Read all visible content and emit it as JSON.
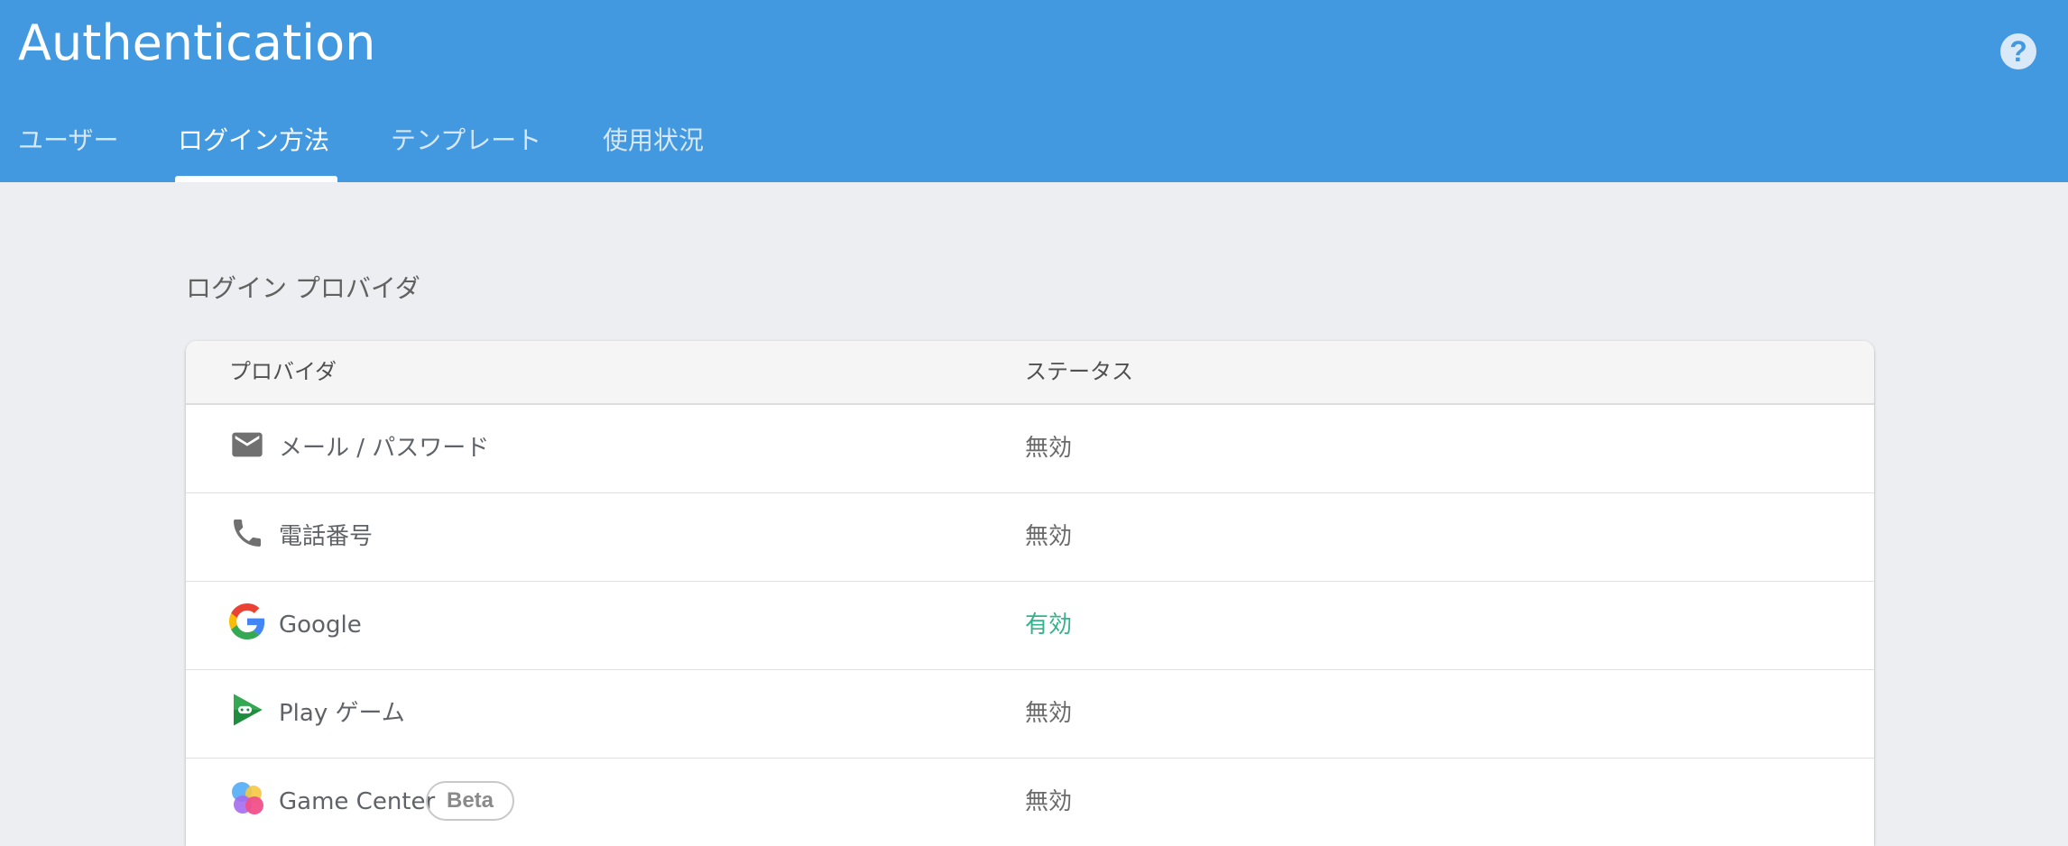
{
  "header": {
    "title": "Authentication",
    "help_icon": "help-circle-icon",
    "help_glyph": "?",
    "tabs": [
      {
        "label": "ユーザー",
        "active": false
      },
      {
        "label": "ログイン方法",
        "active": true
      },
      {
        "label": "テンプレート",
        "active": false
      },
      {
        "label": "使用状況",
        "active": false
      }
    ]
  },
  "colors": {
    "header_bg": "#4399e0",
    "page_bg": "#eceef1",
    "enabled_status": "#34b28a"
  },
  "section": {
    "title": "ログイン プロバイダ"
  },
  "table": {
    "columns": {
      "provider": "プロバイダ",
      "status": "ステータス"
    },
    "rows": [
      {
        "icon": "email-icon",
        "label": "メール / パスワード",
        "status": "無効",
        "badge": ""
      },
      {
        "icon": "phone-icon",
        "label": "電話番号",
        "status": "無効",
        "badge": ""
      },
      {
        "icon": "google-icon",
        "label": "Google",
        "status": "有効",
        "badge": ""
      },
      {
        "icon": "play-games-icon",
        "label": "Play ゲーム",
        "status": "無効",
        "badge": ""
      },
      {
        "icon": "game-center-icon",
        "label": "Game Center",
        "status": "無効",
        "badge": "Beta"
      }
    ]
  }
}
